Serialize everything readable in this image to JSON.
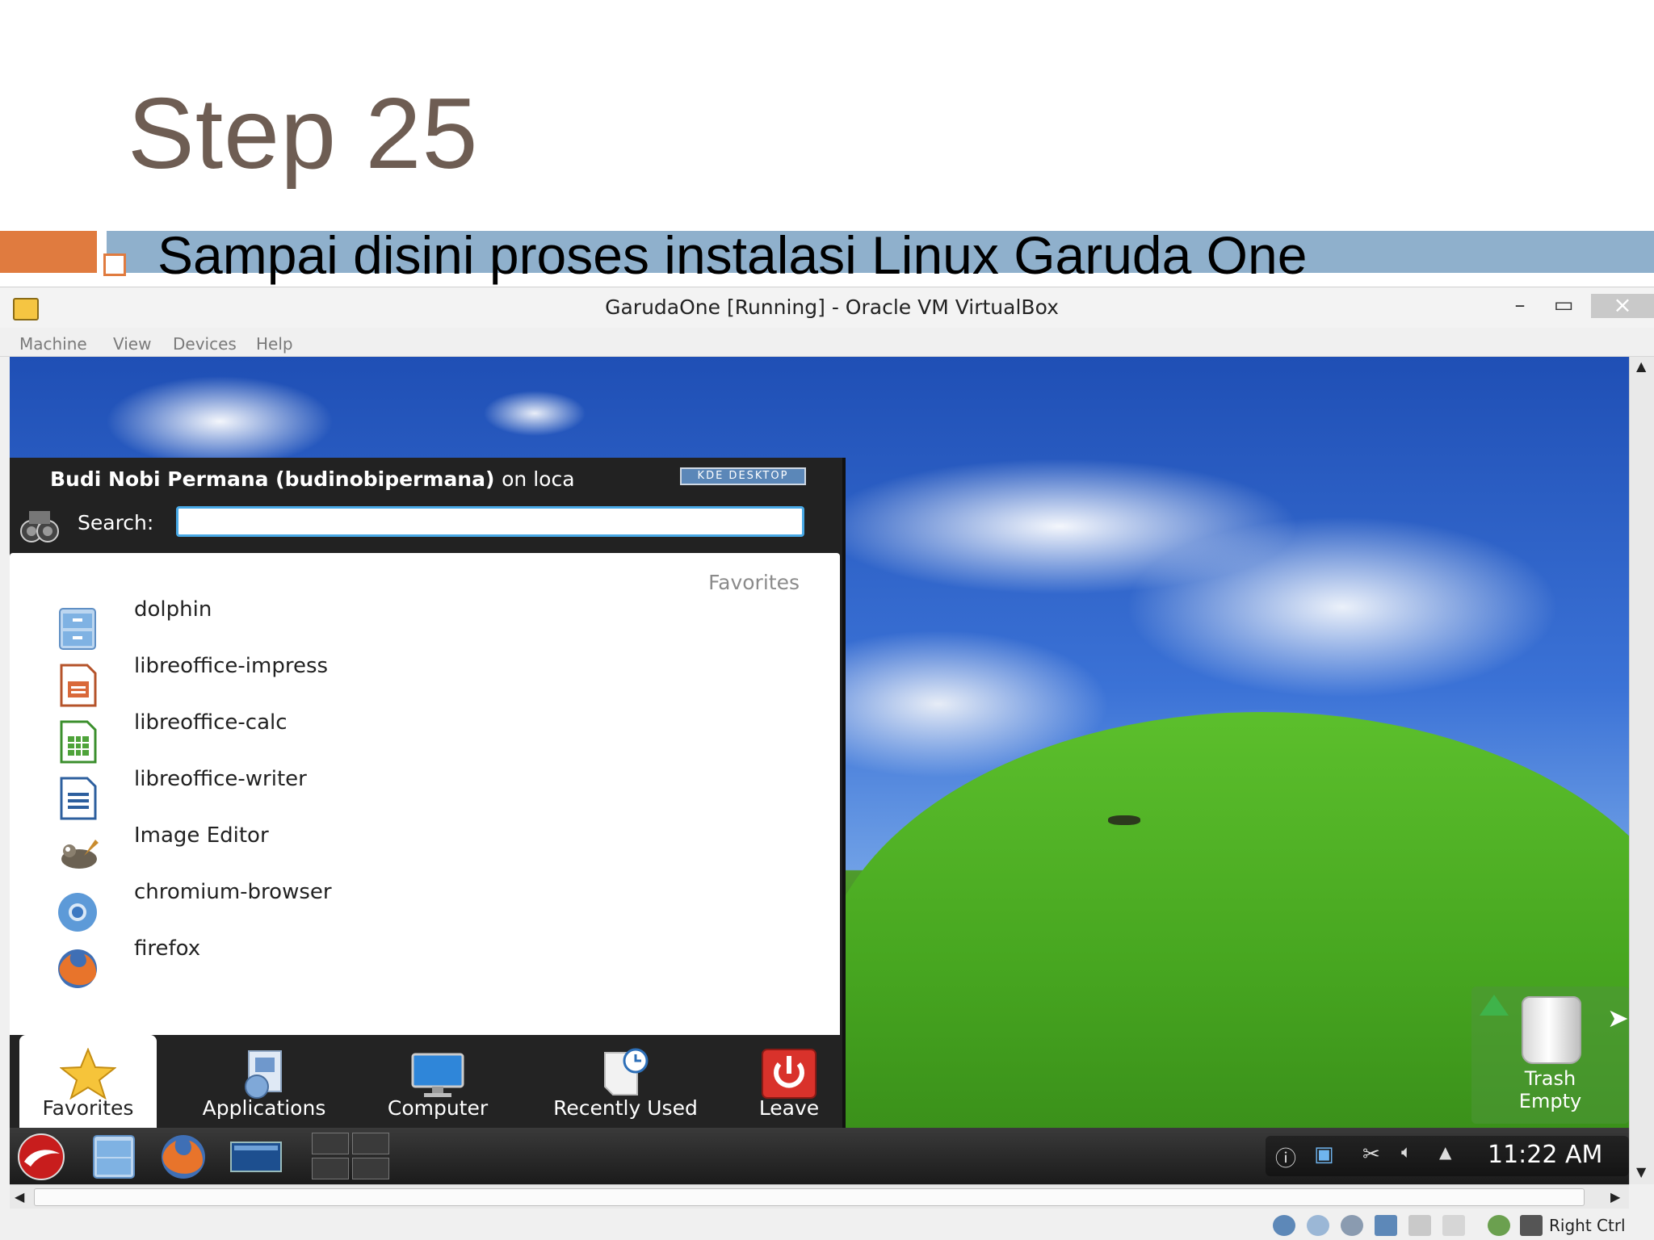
{
  "slide": {
    "title": "Step 25",
    "bullet": "Sampai disini proses instalasi Linux Garuda One"
  },
  "vbox": {
    "title": "GarudaOne [Running] - Oracle VM VirtualBox",
    "menu": [
      "Machine",
      "View",
      "Devices",
      "Help"
    ],
    "status_host_key": "Right Ctrl"
  },
  "kde_menu": {
    "user": "Budi Nobi Permana (budinobipermana)",
    "user_on": "on loca",
    "badge": "KDE DESKTOP",
    "search_label": "Search:",
    "search_value": "",
    "favorites_heading": "Favorites",
    "favorites": [
      {
        "label": "dolphin",
        "icon": "file-manager-icon"
      },
      {
        "label": "libreoffice-impress",
        "icon": "impress-icon"
      },
      {
        "label": "libreoffice-calc",
        "icon": "calc-icon"
      },
      {
        "label": "libreoffice-writer",
        "icon": "writer-icon"
      },
      {
        "label": "Image Editor",
        "icon": "gimp-icon"
      },
      {
        "label": "chromium-browser",
        "icon": "chromium-icon"
      },
      {
        "label": "firefox",
        "icon": "firefox-icon"
      }
    ],
    "tabs": [
      {
        "label": "Favorites",
        "icon": "star-icon"
      },
      {
        "label": "Applications",
        "icon": "applications-icon"
      },
      {
        "label": "Computer",
        "icon": "computer-icon"
      },
      {
        "label": "Recently Used",
        "icon": "recent-icon"
      },
      {
        "label": "Leave",
        "icon": "power-icon"
      }
    ]
  },
  "desktop": {
    "trash_line1": "Trash",
    "trash_line2": "Empty"
  },
  "panel": {
    "clock": "11:22 AM"
  }
}
